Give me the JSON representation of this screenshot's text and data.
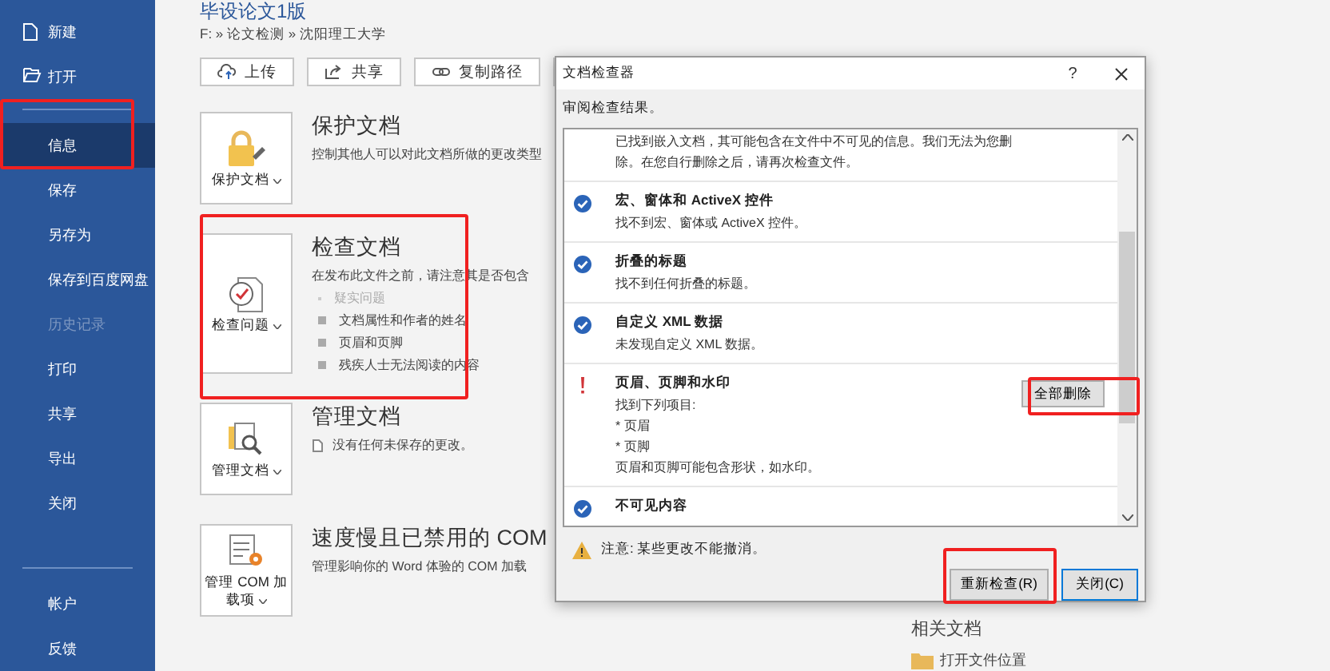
{
  "sidebar": {
    "items": [
      {
        "label": "新建",
        "selected": false,
        "disabled": false
      },
      {
        "label": "打开",
        "selected": false,
        "disabled": false
      },
      {
        "label": "信息",
        "selected": true,
        "disabled": false
      },
      {
        "label": "保存",
        "selected": false,
        "disabled": false
      },
      {
        "label": "另存为",
        "selected": false,
        "disabled": false
      },
      {
        "label": "保存到百度网盘",
        "selected": false,
        "disabled": false
      },
      {
        "label": "历史记录",
        "selected": false,
        "disabled": true
      },
      {
        "label": "打印",
        "selected": false,
        "disabled": false
      },
      {
        "label": "共享",
        "selected": false,
        "disabled": false
      },
      {
        "label": "导出",
        "selected": false,
        "disabled": false
      },
      {
        "label": "关闭",
        "selected": false,
        "disabled": false
      }
    ],
    "bottom_items": [
      {
        "label": "帐户",
        "selected": false,
        "disabled": false
      },
      {
        "label": "反馈",
        "selected": false,
        "disabled": false
      }
    ]
  },
  "document": {
    "title": "毕设论文1版",
    "path": "F: » 论文检测 » 沈阳理工大学"
  },
  "toolbar": [
    {
      "label": "上传"
    },
    {
      "label": "共享"
    },
    {
      "label": "复制路径"
    }
  ],
  "cards": [
    {
      "button": "保护文档",
      "title": "保护文档",
      "description": "控制其他人可以对此文档所做的更改类型"
    },
    {
      "button": "检查问题",
      "title": "检查文档",
      "description": "在发布此文件之前，请注意其是否包含",
      "bullets": [
        {
          "text": "疑实问题",
          "disabled": true
        },
        {
          "text": "文档属性和作者的姓名",
          "disabled": false
        },
        {
          "text": "页眉和页脚",
          "disabled": false
        },
        {
          "text": "残疾人士无法阅读的内容",
          "disabled": false
        }
      ]
    },
    {
      "button": "管理文档",
      "title": "管理文档",
      "description": "没有任何未保存的更改。"
    },
    {
      "button": "管理 COM 加载项",
      "title": "速度慢且已禁用的 COM",
      "description": "管理影响你的 Word 体验的 COM 加载"
    }
  ],
  "related": {
    "title": "相关文档",
    "link": "打开文件位置"
  },
  "dialog": {
    "title": "文档检查器",
    "help": "?",
    "subtitle": "审阅检查结果。",
    "results": [
      {
        "kind": "partial",
        "lines": [
          "已找到嵌入文档，其可能包含在文件中不可见的信息。我们无法为您删",
          "除。在您自行删除之后，请再次检查文件。"
        ]
      },
      {
        "kind": "ok",
        "title": "宏、窗体和 ActiveX 控件",
        "lines": [
          "找不到宏、窗体或 ActiveX 控件。"
        ]
      },
      {
        "kind": "ok",
        "title": "折叠的标题",
        "lines": [
          "找不到任何折叠的标题。"
        ]
      },
      {
        "kind": "ok",
        "title": "自定义 XML 数据",
        "lines": [
          "未发现自定义 XML 数据。"
        ]
      },
      {
        "kind": "warning",
        "title": "页眉、页脚和水印",
        "lines": [
          "找到下列项目:",
          "* 页眉",
          "* 页脚",
          "页眉和页脚可能包含形状，如水印。"
        ],
        "action": "全部删除"
      },
      {
        "kind": "ok",
        "title": "不可见内容"
      }
    ],
    "note": "注意: 某些更改不能撤消。",
    "buttons": [
      {
        "label": "重新检查(R)",
        "default": false
      },
      {
        "label": "关闭(C)",
        "default": true
      }
    ]
  }
}
